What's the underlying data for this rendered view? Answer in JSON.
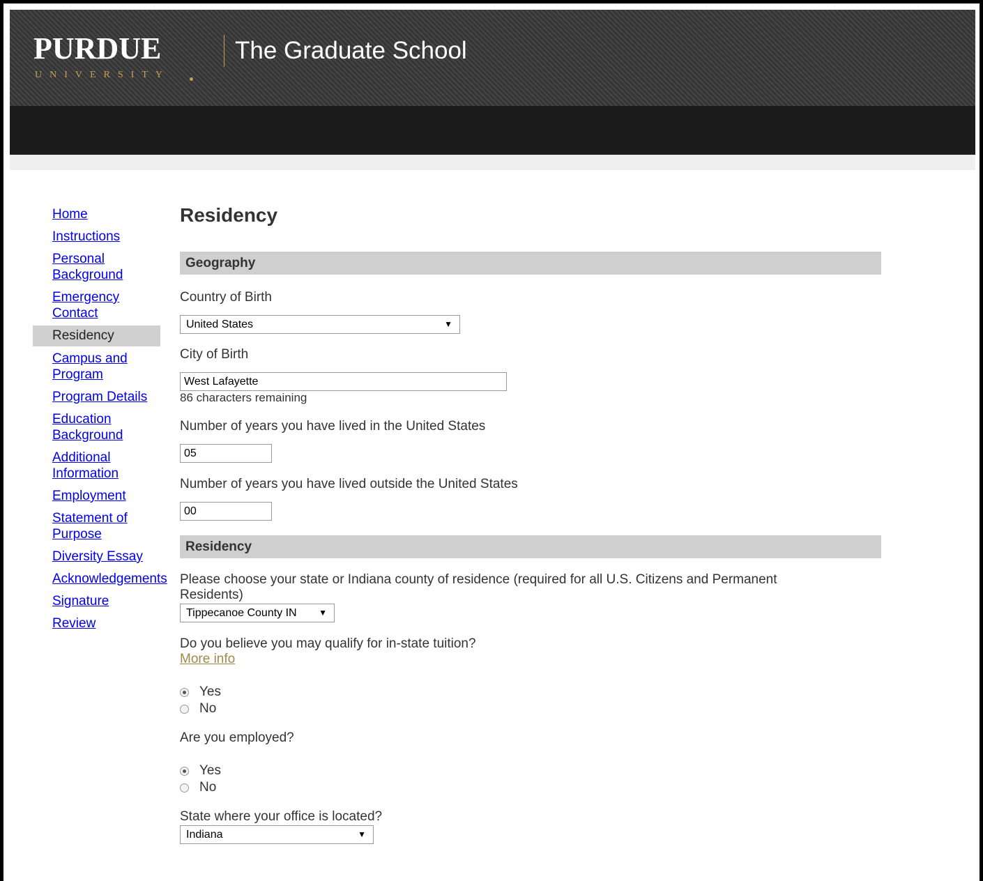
{
  "header": {
    "logo_word": "PURDUE",
    "logo_sub": "UNIVERSITY",
    "site_title": "The Graduate School"
  },
  "nav": {
    "items": [
      {
        "label": "Home"
      },
      {
        "label": "Instructions"
      },
      {
        "label": "Personal Background"
      },
      {
        "label": "Emergency Contact"
      },
      {
        "label": "Residency"
      },
      {
        "label": "Campus and Program"
      },
      {
        "label": "Program Details"
      },
      {
        "label": "Education Background"
      },
      {
        "label": "Additional Information"
      },
      {
        "label": "Employment"
      },
      {
        "label": "Statement of Purpose"
      },
      {
        "label": "Diversity Essay"
      },
      {
        "label": "Acknowledgements"
      },
      {
        "label": "Signature"
      },
      {
        "label": "Review"
      }
    ]
  },
  "page": {
    "title": "Residency",
    "geography": {
      "heading": "Geography",
      "country_label": "Country of Birth",
      "country_value": "United States",
      "city_label": "City of Birth",
      "city_value": "West Lafayette",
      "city_hint": "86 characters remaining",
      "years_in_label": "Number of years you have lived in the United States",
      "years_in_value": "05",
      "years_out_label": "Number of years you have lived outside the United States",
      "years_out_value": "00"
    },
    "residency": {
      "heading": "Residency",
      "state_label": "Please choose your state or Indiana county of residence (required for all U.S. Citizens and Permanent Residents)",
      "state_value": "Tippecanoe County IN",
      "tuition_question": "Do you believe you may qualify for in-state tuition?",
      "more_info": "More info",
      "tuition_yes": "Yes",
      "tuition_no": "No",
      "employed_question": "Are you employed?",
      "employed_yes": "Yes",
      "employed_no": "No",
      "office_label": "State where your office is located?",
      "office_value": "Indiana"
    }
  },
  "icons": {
    "dropdown": "▼"
  }
}
